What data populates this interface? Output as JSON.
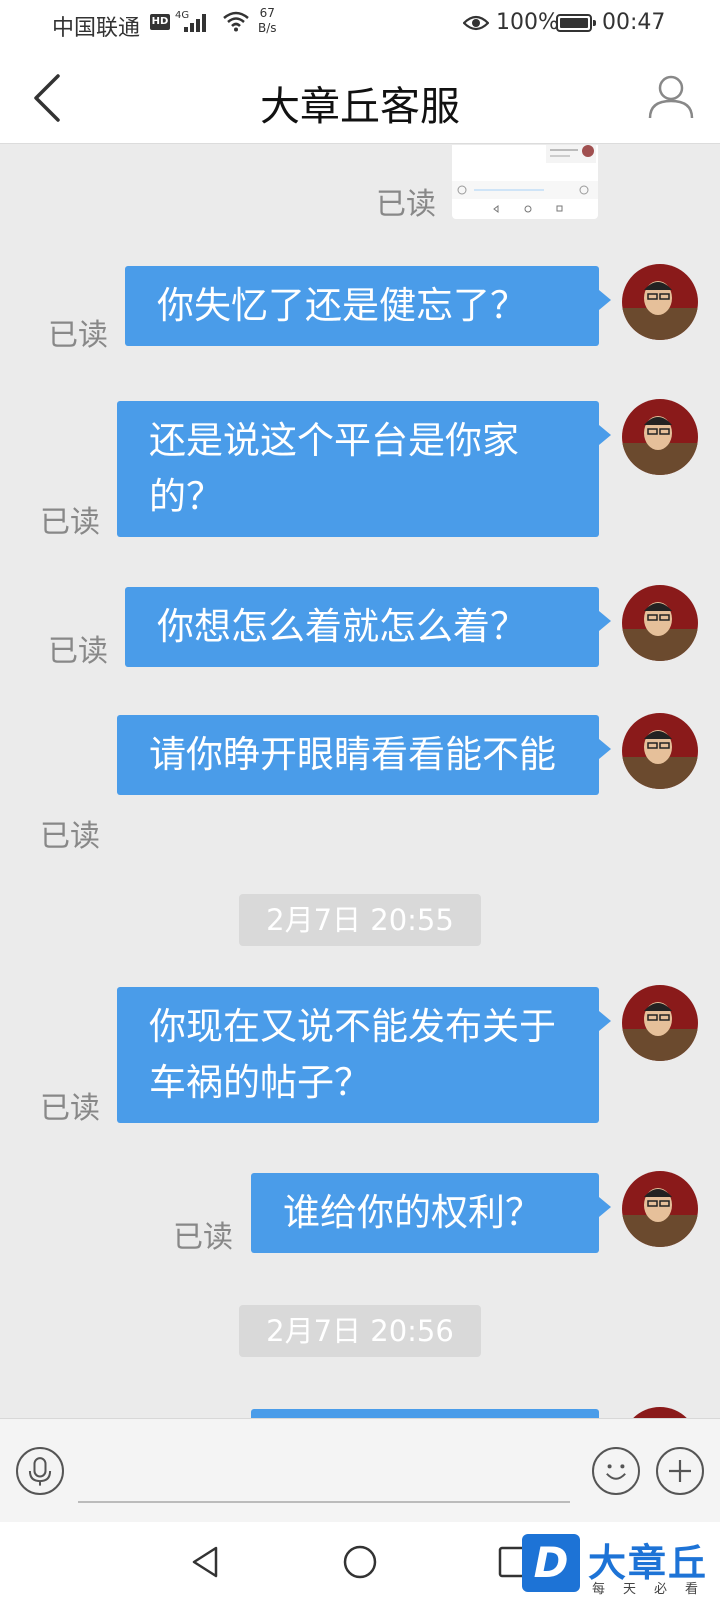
{
  "status_bar": {
    "carrier": "中国联通",
    "hd": "HD",
    "network": "4G",
    "speed_value": "67",
    "speed_unit": "B/s",
    "battery": "100%",
    "time": "00:47"
  },
  "header": {
    "title": "大章丘客服"
  },
  "chat": {
    "read_label": "已读",
    "messages": [
      {
        "text": "你失忆了还是健忘了？"
      },
      {
        "text": "还是说这个平台是你家的？"
      },
      {
        "text": "你想怎么着就怎么着？"
      },
      {
        "text": "请你睁开眼睛看看能不能"
      },
      {
        "text": "你现在又说不能发布关于车祸的帖子？"
      },
      {
        "text": "谁给你的权利？"
      }
    ],
    "timestamps": [
      "2月7日 20:55",
      "2月7日 20:56"
    ]
  },
  "input_bar": {
    "placeholder": ""
  },
  "icons": [
    "back-icon",
    "user-icon",
    "mic-icon",
    "emoji-icon",
    "plus-icon",
    "nav-back-icon",
    "nav-home-icon",
    "nav-recents-icon"
  ],
  "watermark": {
    "name": "大章丘",
    "slogan": "每天必看"
  },
  "colors": {
    "bubble": "#4a9ce9",
    "chat_background": "#ebebeb",
    "brand": "#1d73d6"
  }
}
